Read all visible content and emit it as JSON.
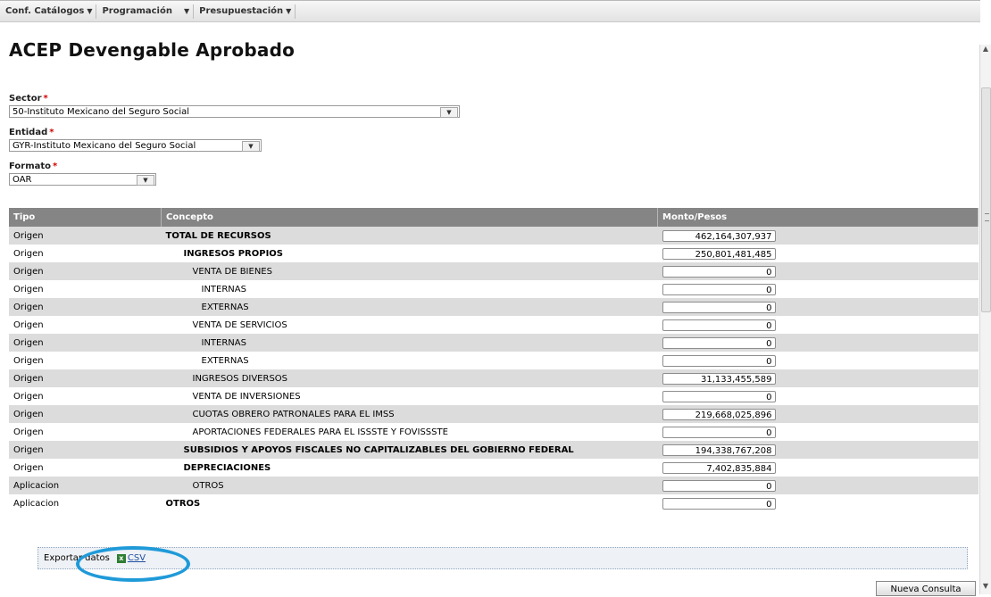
{
  "menu": [
    {
      "label": "Conf. Catálogos",
      "caret": "▼"
    },
    {
      "label": "Programación",
      "caret": "▼"
    },
    {
      "label": "Presupuestación",
      "caret": "▼"
    }
  ],
  "page_title": "ACEP Devengable Aprobado",
  "form": {
    "sector": {
      "label": "Sector",
      "required": "*",
      "value": "50-Instituto Mexicano del Seguro Social"
    },
    "entidad": {
      "label": "Entidad",
      "required": "*",
      "value": "GYR-Instituto Mexicano del Seguro Social"
    },
    "formato": {
      "label": "Formato",
      "required": "*",
      "value": "OAR"
    }
  },
  "table": {
    "headers": {
      "tipo": "Tipo",
      "concepto": "Concepto",
      "monto": "Monto/Pesos"
    },
    "rows": [
      {
        "tipo": "Origen",
        "concepto": "TOTAL DE RECURSOS",
        "monto": "462,164,307,937",
        "bold": true,
        "indent": 0
      },
      {
        "tipo": "Origen",
        "concepto": "INGRESOS PROPIOS",
        "monto": "250,801,481,485",
        "bold": true,
        "indent": 1
      },
      {
        "tipo": "Origen",
        "concepto": "VENTA DE BIENES",
        "monto": "0",
        "bold": false,
        "indent": 2
      },
      {
        "tipo": "Origen",
        "concepto": "INTERNAS",
        "monto": "0",
        "bold": false,
        "indent": 3
      },
      {
        "tipo": "Origen",
        "concepto": "EXTERNAS",
        "monto": "0",
        "bold": false,
        "indent": 3
      },
      {
        "tipo": "Origen",
        "concepto": "VENTA DE SERVICIOS",
        "monto": "0",
        "bold": false,
        "indent": 2
      },
      {
        "tipo": "Origen",
        "concepto": "INTERNAS",
        "monto": "0",
        "bold": false,
        "indent": 3
      },
      {
        "tipo": "Origen",
        "concepto": "EXTERNAS",
        "monto": "0",
        "bold": false,
        "indent": 3
      },
      {
        "tipo": "Origen",
        "concepto": "INGRESOS DIVERSOS",
        "monto": "31,133,455,589",
        "bold": false,
        "indent": 2
      },
      {
        "tipo": "Origen",
        "concepto": "VENTA DE INVERSIONES",
        "monto": "0",
        "bold": false,
        "indent": 2
      },
      {
        "tipo": "Origen",
        "concepto": "CUOTAS OBRERO PATRONALES PARA EL IMSS",
        "monto": "219,668,025,896",
        "bold": false,
        "indent": 2
      },
      {
        "tipo": "Origen",
        "concepto": "APORTACIONES FEDERALES PARA EL ISSSTE Y FOVISSSTE",
        "monto": "0",
        "bold": false,
        "indent": 2
      },
      {
        "tipo": "Origen",
        "concepto": "SUBSIDIOS Y APOYOS FISCALES NO CAPITALIZABLES DEL GOBIERNO FEDERAL",
        "monto": "194,338,767,208",
        "bold": true,
        "indent": 1
      },
      {
        "tipo": "Origen",
        "concepto": "DEPRECIACIONES",
        "monto": "7,402,835,884",
        "bold": true,
        "indent": 1
      },
      {
        "tipo": "Aplicacion",
        "concepto": "OTROS",
        "monto": "0",
        "bold": false,
        "indent": 2
      },
      {
        "tipo": "Aplicacion",
        "concepto": "OTROS",
        "monto": "0",
        "bold": true,
        "indent": 0
      }
    ]
  },
  "export": {
    "label": "Exportar datos",
    "icon": "csv-file-icon",
    "link": "CSV"
  },
  "buttons": {
    "nueva_consulta": "Nueva Consulta"
  },
  "colors": {
    "header_bg": "#858585",
    "row_alt": "#dcdcdc",
    "highlight_oval": "#1f9ad8",
    "link": "#1f4fa3"
  }
}
